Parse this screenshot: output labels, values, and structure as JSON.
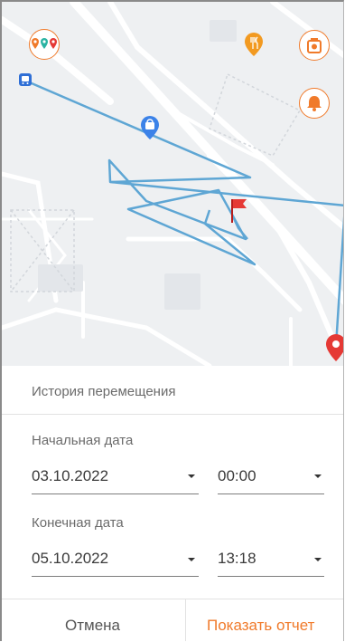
{
  "panel": {
    "title": "История перемещения",
    "start_label": "Начальная дата",
    "start_date": "03.10.2022",
    "start_time": "00:00",
    "end_label": "Конечная дата",
    "end_date": "05.10.2022",
    "end_time": "13:18"
  },
  "buttons": {
    "cancel": "Отмена",
    "show_report": "Показать отчет"
  },
  "colors": {
    "accent": "#f07a2a",
    "track": "#5ea6d4",
    "end_pin": "#e53935",
    "flag": "#e53935"
  },
  "map_icons": [
    "multi-pin-icon",
    "restaurant-icon",
    "settings-icon",
    "bell-icon",
    "bus-stop-icon",
    "shopping-icon",
    "flag-icon",
    "end-pin-icon"
  ]
}
